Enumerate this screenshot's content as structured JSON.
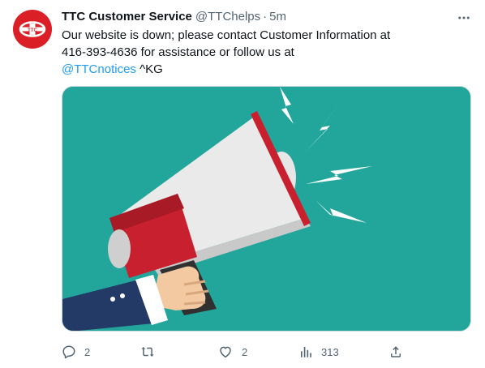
{
  "tweet": {
    "author": {
      "display_name": "TTC Customer Service",
      "handle": "@TTChelps",
      "avatar_color": "#da1f26"
    },
    "separator": "·",
    "timestamp": "5m",
    "text": {
      "line1": "Our website is down; please contact Customer Information at",
      "line2": "416-393-4636 for assistance or follow us at",
      "mention": "@TTCnotices",
      "suffix": " ^KG"
    },
    "media": {
      "description_icon": "megaphone-illustration-icon",
      "background_color": "#22a69b"
    },
    "metrics": {
      "replies": "2",
      "retweets": "",
      "likes": "2",
      "views": "313"
    },
    "colors": {
      "link": "#1d9bf0",
      "secondary_text": "#536471"
    }
  }
}
